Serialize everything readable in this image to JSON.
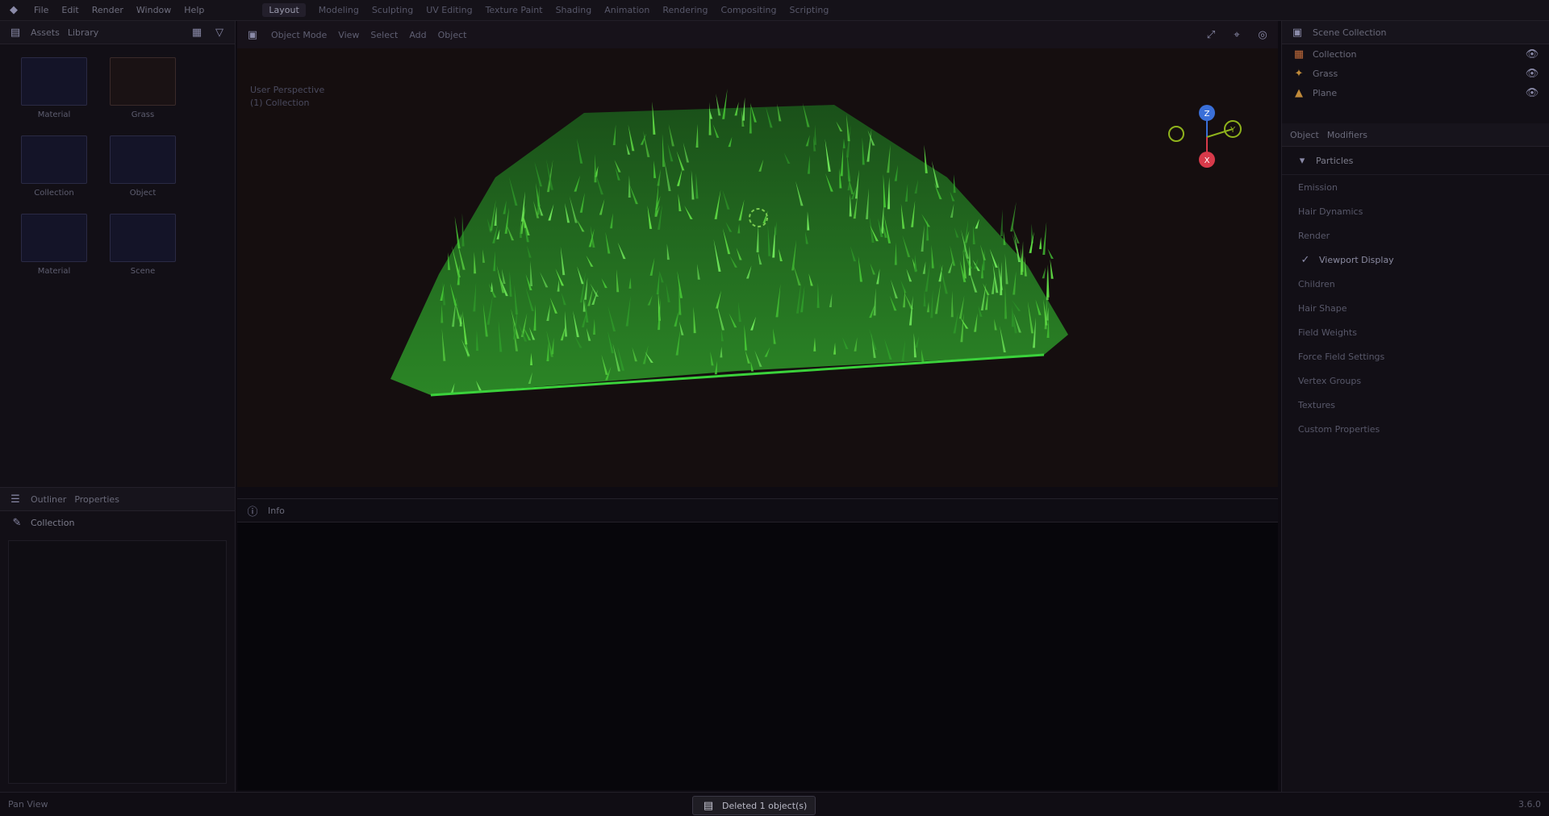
{
  "menu": {
    "items": [
      "File",
      "Edit",
      "Render",
      "Window",
      "Help"
    ],
    "workspaces": [
      "Layout",
      "Modeling",
      "Sculpting",
      "UV Editing",
      "Texture Paint",
      "Shading",
      "Animation",
      "Rendering",
      "Compositing",
      "Scripting"
    ],
    "active_workspace": "Layout"
  },
  "left_panel": {
    "header_tabs": [
      "Assets",
      "Library"
    ],
    "assets": [
      {
        "label": "Material"
      },
      {
        "label": "Grass"
      },
      {
        "label": "Collection"
      },
      {
        "label": "Object"
      },
      {
        "label": "Material"
      },
      {
        "label": "Scene"
      }
    ]
  },
  "left_bottom": {
    "tabs": [
      "Outliner",
      "Properties"
    ],
    "sub_label": "Collection"
  },
  "viewport": {
    "header_items": [
      "Object Mode",
      "View",
      "Select",
      "Add",
      "Object"
    ],
    "info_lines": [
      "User Perspective",
      "(1) Collection"
    ],
    "gizmo": {
      "x": "X",
      "y": "Y",
      "z": "Z"
    }
  },
  "console": {
    "title": "Info",
    "lines": []
  },
  "right_panel": {
    "outliner_title": "Scene Collection",
    "outliner_rows": [
      {
        "name": "Collection"
      },
      {
        "name": "Grass"
      },
      {
        "name": "Plane"
      }
    ],
    "properties_tabs": [
      "Object",
      "Modifiers"
    ],
    "section_title": "Particles",
    "fields": [
      {
        "label": "Emission"
      },
      {
        "label": "Hair Dynamics"
      },
      {
        "label": "Render"
      }
    ],
    "checkbox_items": [
      {
        "label": "Viewport Display",
        "checked": true
      },
      {
        "label": "Children"
      },
      {
        "label": "Hair Shape"
      },
      {
        "label": "Field Weights"
      },
      {
        "label": "Force Field Settings"
      },
      {
        "label": "Vertex Groups"
      },
      {
        "label": "Textures"
      },
      {
        "label": "Custom Properties"
      }
    ]
  },
  "status": {
    "left": "Pan View",
    "message": "Deleted 1 object(s)",
    "right": "3.6.0"
  },
  "colors": {
    "grass_dark": "#1f6b1f",
    "grass_light": "#5fdc44",
    "axis_x": "#d83a4a",
    "axis_y": "#8fb21c",
    "axis_z": "#3a6fd8"
  }
}
